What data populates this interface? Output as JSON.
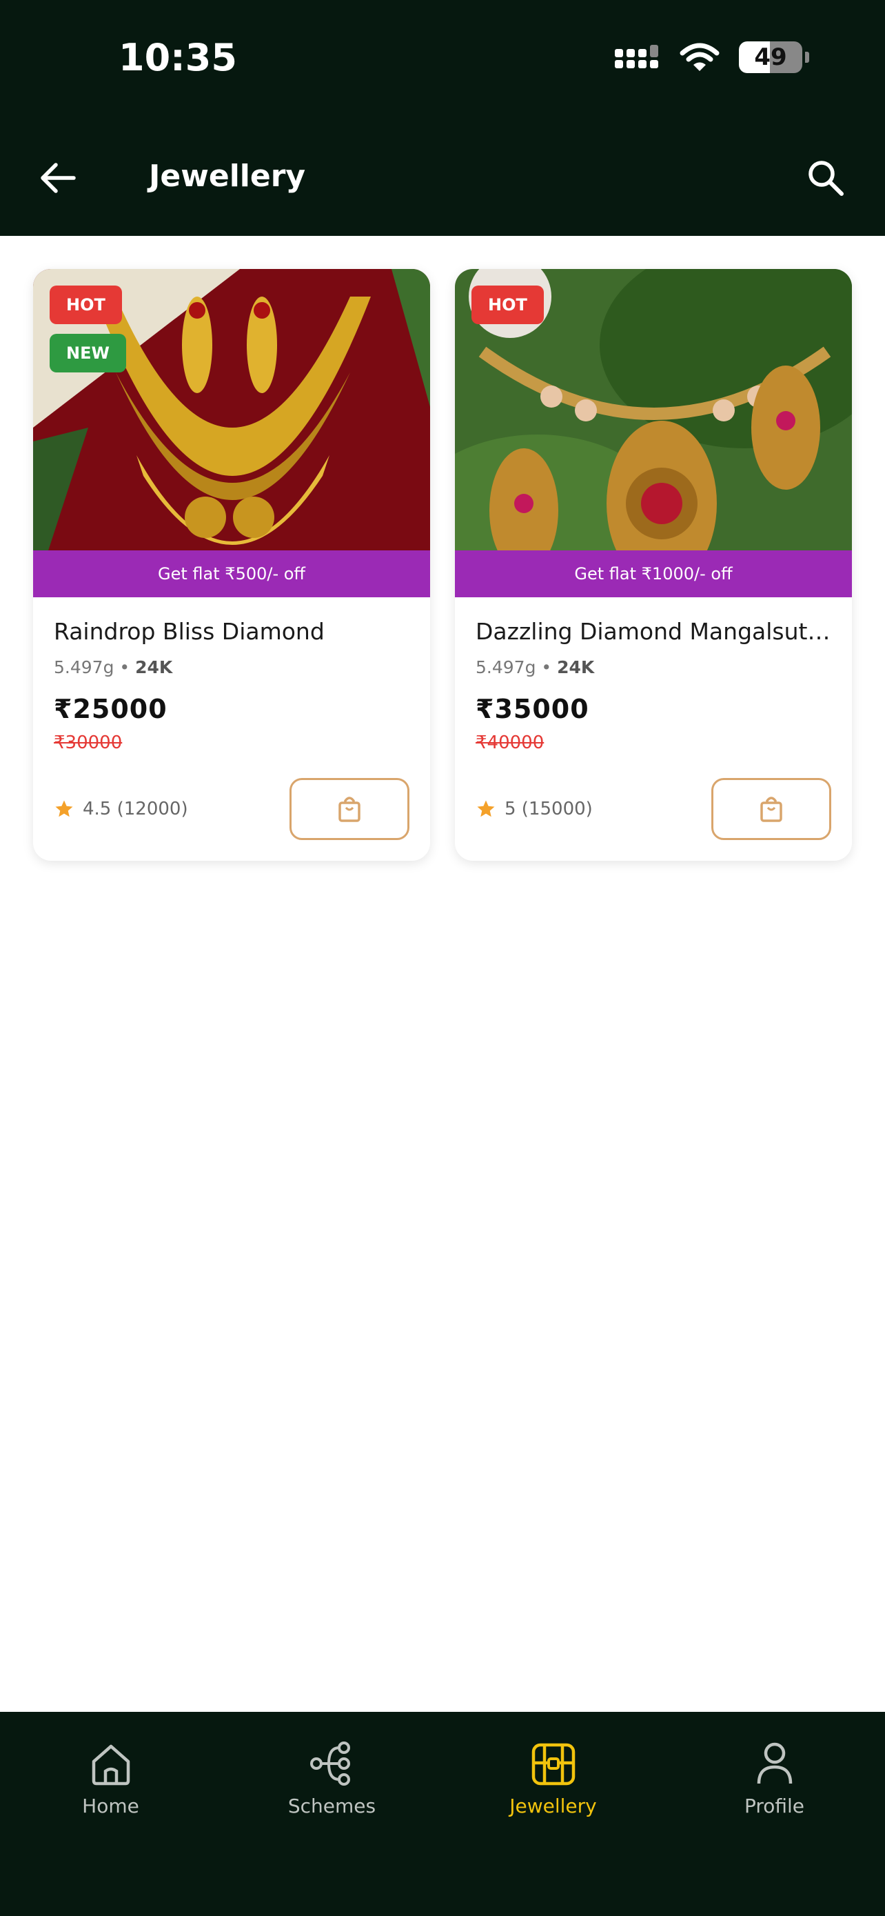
{
  "status_bar": {
    "time": "10:35",
    "battery": "49"
  },
  "header": {
    "title": "Jewellery",
    "back_icon": "arrow-left-icon",
    "search_icon": "search-icon"
  },
  "products": [
    {
      "badges": [
        "HOT",
        "NEW"
      ],
      "offer": "Get flat ₹500/- off",
      "name": "Raindrop Bliss Diamond",
      "weight": "5.497g",
      "separator": "•",
      "purity": "24K",
      "price": "₹25000",
      "mrp": "₹30000",
      "rating": "4.5 (12000)"
    },
    {
      "badges": [
        "HOT"
      ],
      "offer": "Get flat ₹1000/- off",
      "name": "Dazzling Diamond Mangalsutr...",
      "weight": "5.497g",
      "separator": "•",
      "purity": "24K",
      "price": "₹35000",
      "mrp": "₹40000",
      "rating": "5 (15000)"
    }
  ],
  "bottom_nav": [
    {
      "label": "Home",
      "icon": "home-icon"
    },
    {
      "label": "Schemes",
      "icon": "share-nodes-icon"
    },
    {
      "label": "Jewellery",
      "icon": "treasure-box-icon",
      "active": true
    },
    {
      "label": "Profile",
      "icon": "person-icon"
    }
  ],
  "colors": {
    "background_dark": "#06180f",
    "offer_strip": "#9b2ab5",
    "hot_badge": "#e53935",
    "new_badge": "#2e9a41",
    "active_nav": "#f2c30d",
    "cart_border": "#d9a56c"
  }
}
